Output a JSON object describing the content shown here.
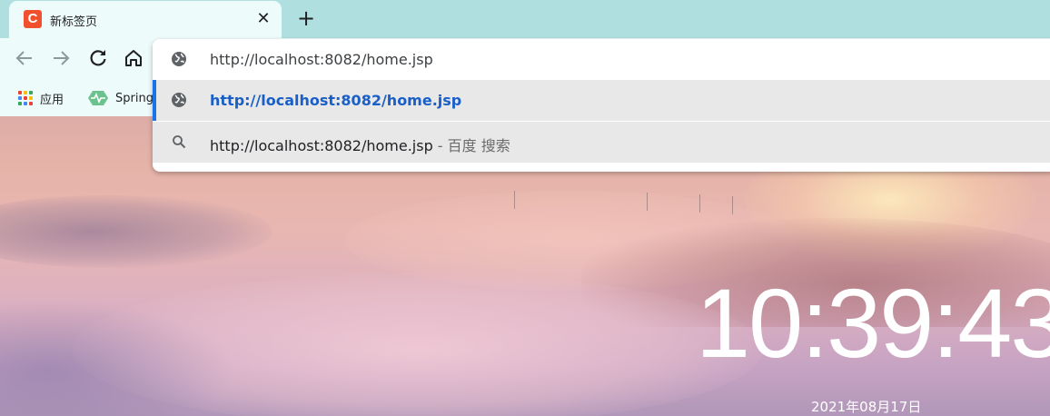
{
  "tab": {
    "title": "新标签页",
    "favicon_letter": "C",
    "favicon_color": "#f0502e"
  },
  "toolbar": {
    "back_icon": "arrow-left-icon",
    "forward_icon": "arrow-right-icon",
    "reload_icon": "reload-icon",
    "home_icon": "home-icon"
  },
  "bookmarks": [
    {
      "label": "应用",
      "icon": "apps-grid-icon"
    },
    {
      "label": "Spring",
      "icon": "spring-icon"
    }
  ],
  "omnibox": {
    "value": "http://localhost:8082/home.jsp",
    "suggestions": [
      {
        "text": "http://localhost:8082/home.jsp",
        "hint": "",
        "icon": "globe-icon",
        "selected": true
      },
      {
        "text": "http://localhost:8082/home.jsp",
        "hint": " - 百度 搜索",
        "icon": "search-icon",
        "selected": false
      }
    ]
  },
  "clock": {
    "time": "10:39:43",
    "date": "2021年08月17日"
  },
  "colors": {
    "accent": "#1a73e8",
    "link": "#1a5fc7",
    "tabstrip": "#b0dfdf",
    "toolbar": "#edfbfb"
  }
}
